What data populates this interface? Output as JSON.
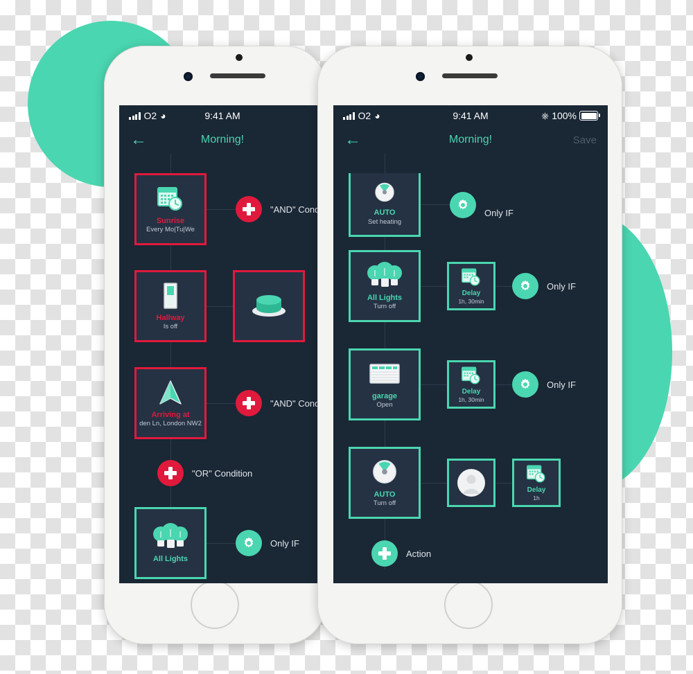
{
  "theme": {
    "accent_teal": "#4ad6b0",
    "accent_red": "#e01a3c",
    "screen_bg": "#1a2735",
    "card_bg": "#253244"
  },
  "phone_left": {
    "status_bar": {
      "carrier": "O2",
      "time": "9:41 AM",
      "signal_icon": "signal-bars-icon",
      "wifi_icon": "wifi-icon"
    },
    "nav": {
      "back_icon": "back-arrow-icon",
      "title": "Morning!"
    },
    "rows": [
      {
        "card": {
          "icon": "calendar-clock-icon",
          "title": "Sunrise",
          "subtitle": "Every Mo|Tu|We",
          "state": "red"
        },
        "node": {
          "icon": "plus-icon",
          "color": "red",
          "label": "\"AND\" Condit"
        }
      },
      {
        "card": {
          "icon": "toggle-switch-icon",
          "title": "Hallway",
          "subtitle": "Is off",
          "state": "red"
        },
        "card2": {
          "icon": "green-button-icon",
          "title": "",
          "subtitle": "",
          "state": "red"
        }
      },
      {
        "card": {
          "icon": "navigation-arrow-icon",
          "title": "Arriving at",
          "subtitle": "den Ln, London NW2",
          "state": "red"
        },
        "node": {
          "icon": "plus-icon",
          "color": "red",
          "label": "\"AND\" Condit"
        }
      },
      {
        "node": {
          "icon": "plus-icon",
          "color": "red",
          "label": "\"OR\" Condition"
        }
      },
      {
        "card": {
          "icon": "light-bulbs-icon",
          "title": "All Lights",
          "subtitle": "",
          "state": "green"
        },
        "node": {
          "icon": "gear-icon",
          "color": "green",
          "label": "Only IF"
        }
      }
    ]
  },
  "phone_right": {
    "status_bar": {
      "carrier": "O2",
      "time": "9:41 AM",
      "bluetooth_icon": "bluetooth-icon",
      "battery_percent": "100%",
      "signal_icon": "signal-bars-icon",
      "wifi_icon": "wifi-icon"
    },
    "nav": {
      "back_icon": "back-arrow-icon",
      "title": "Morning!",
      "save_label": "Save"
    },
    "rows": [
      {
        "card": {
          "icon": "thermostat-dial-icon",
          "title": "AUTO",
          "subtitle": "Set heating",
          "state": "green"
        },
        "node": {
          "icon": "gear-icon",
          "color": "green",
          "label": "Only IF"
        }
      },
      {
        "card": {
          "icon": "light-bulbs-icon",
          "title": "All Lights",
          "subtitle": "Turn off",
          "state": "green"
        },
        "card2": {
          "icon": "calendar-clock-icon",
          "title": "Delay",
          "subtitle": "1h, 30min",
          "state": "green"
        },
        "node": {
          "icon": "gear-icon",
          "color": "green",
          "label": "Only IF"
        }
      },
      {
        "card": {
          "icon": "garage-door-icon",
          "title": "garage",
          "subtitle": "Open",
          "state": "green"
        },
        "card2": {
          "icon": "calendar-clock-icon",
          "title": "Delay",
          "subtitle": "1h, 30min",
          "state": "green"
        },
        "node": {
          "icon": "gear-icon",
          "color": "green",
          "label": "Only IF"
        }
      },
      {
        "card": {
          "icon": "thermostat-dial-icon",
          "title": "AUTO",
          "subtitle": "Turn off",
          "state": "green"
        },
        "card2": {
          "icon": "person-avatar-icon",
          "title": "",
          "subtitle": "",
          "state": "green"
        },
        "card3": {
          "icon": "calendar-clock-icon",
          "title": "Delay",
          "subtitle": "1h",
          "state": "green"
        }
      },
      {
        "node": {
          "icon": "plus-icon",
          "color": "green",
          "label": "Action"
        }
      }
    ]
  }
}
